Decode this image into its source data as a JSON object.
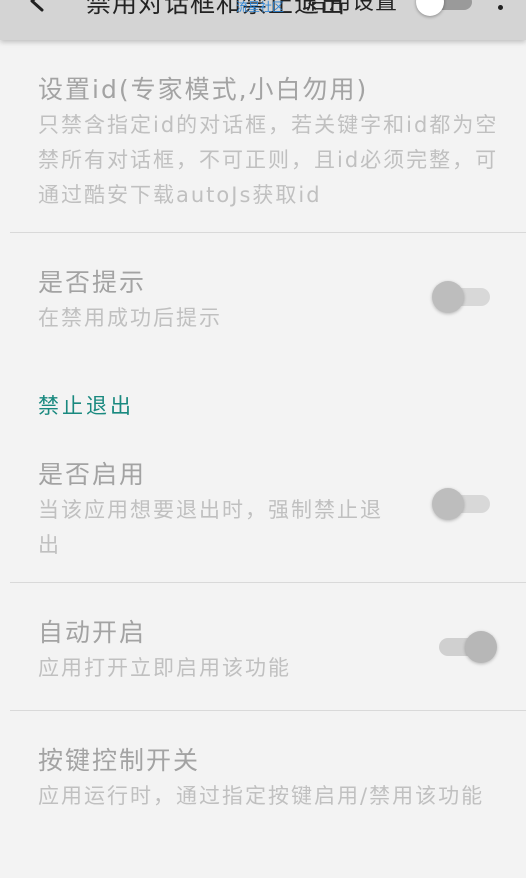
{
  "toolbar": {
    "title": "禁用对话框和禁止退出",
    "watermark": "流星社区",
    "switch_label": "启用设置",
    "switch_state": "off"
  },
  "prefs": {
    "set_id": {
      "title": "设置id(专家模式,小白勿用)",
      "summary": "只禁含指定id的对话框，若关键字和id都为空禁所有对话框，不可正则，且id必须完整，可通过酷安下载autoJs获取id"
    },
    "notify": {
      "title": "是否提示",
      "summary": "在禁用成功后提示",
      "enabled": false
    },
    "category_exit": "禁止退出",
    "exit_enable": {
      "title": "是否启用",
      "summary": "当该应用想要退出时，强制禁止退出",
      "enabled": false
    },
    "auto_start": {
      "title": "自动开启",
      "summary": "应用打开立即启用该功能",
      "enabled": true
    },
    "key_control": {
      "title": "按键控制开关",
      "summary": "应用运行时，通过指定按键启用/禁用该功能"
    }
  }
}
